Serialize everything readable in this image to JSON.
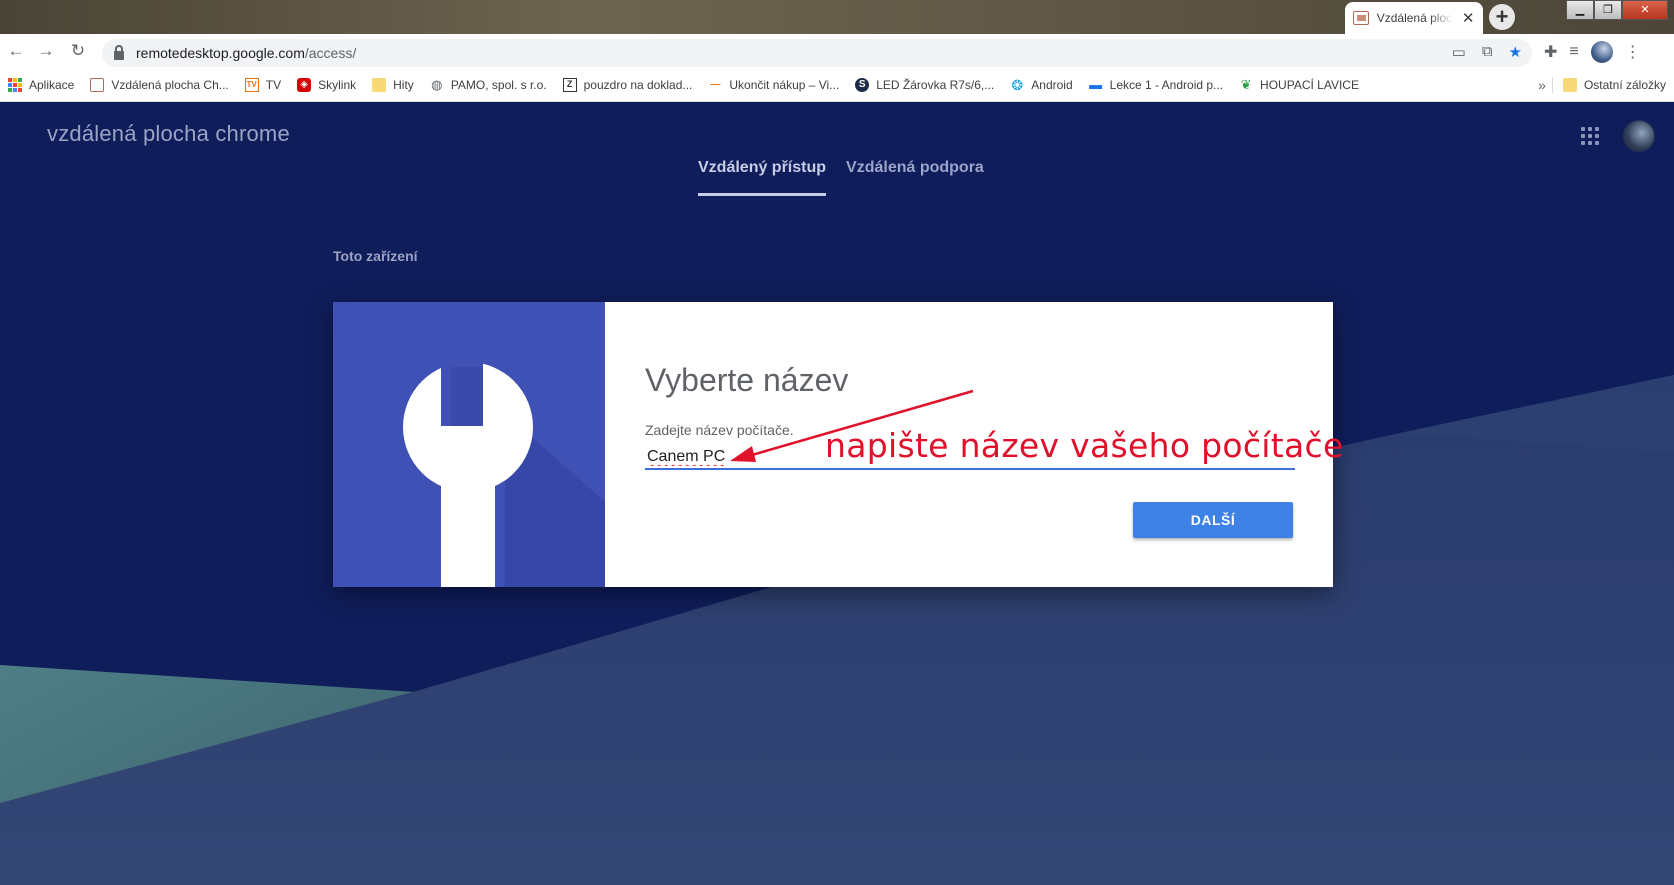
{
  "browser": {
    "tab_title": "Vzdálená plocha Chrome",
    "tab_close": "✕",
    "new_tab": "+",
    "win_minimize": "▁",
    "win_maximize": "❐",
    "win_close": "✕",
    "url_host": "remotedesktop.google.com",
    "url_path": "/access/",
    "nav_back": "←",
    "nav_forward": "→",
    "nav_reload": "↻"
  },
  "bookmarks": {
    "items": [
      {
        "label": "Aplikace",
        "icon": "apps-icon"
      },
      {
        "label": "Vzdálená plocha Ch...",
        "icon": "remote-desktop-icon"
      },
      {
        "label": "TV",
        "icon": "tv-icon"
      },
      {
        "label": "Skylink",
        "icon": "skylink-icon"
      },
      {
        "label": "Hity",
        "icon": "folder-icon"
      },
      {
        "label": "PAMO, spol. s r.o.",
        "icon": "globe-icon"
      },
      {
        "label": "pouzdro na doklad...",
        "icon": "z-icon"
      },
      {
        "label": "Ukončit nákup – Vi...",
        "icon": "dash-icon"
      },
      {
        "label": "LED Žárovka R7s/6,...",
        "icon": "s-icon"
      },
      {
        "label": "Android",
        "icon": "android-icon"
      },
      {
        "label": "Lekce 1 - Android p...",
        "icon": "laptop-icon"
      },
      {
        "label": "HOUPACÍ LAVICE",
        "icon": "leaf-icon"
      }
    ],
    "more": "»",
    "other_bookmarks": "Ostatní záložky"
  },
  "page": {
    "brand": "vzdálená plocha chrome",
    "tabs": [
      {
        "label": "Vzdálený přístup",
        "active": true
      },
      {
        "label": "Vzdálená podpora",
        "active": false
      }
    ],
    "section_label": "Toto zařízení"
  },
  "dialog": {
    "title": "Vyberte název",
    "field_label": "Zadejte název počítače.",
    "input_value": "Canem PC",
    "next_button": "DALŠÍ"
  },
  "annotation": {
    "text": "napište název vašeho počítače",
    "color": "#e0112b"
  },
  "colors": {
    "page_bg": "#0f1d5a",
    "card_art": "#3f51b5",
    "button": "#3e82e6",
    "input_underline": "#3f6fd8"
  }
}
